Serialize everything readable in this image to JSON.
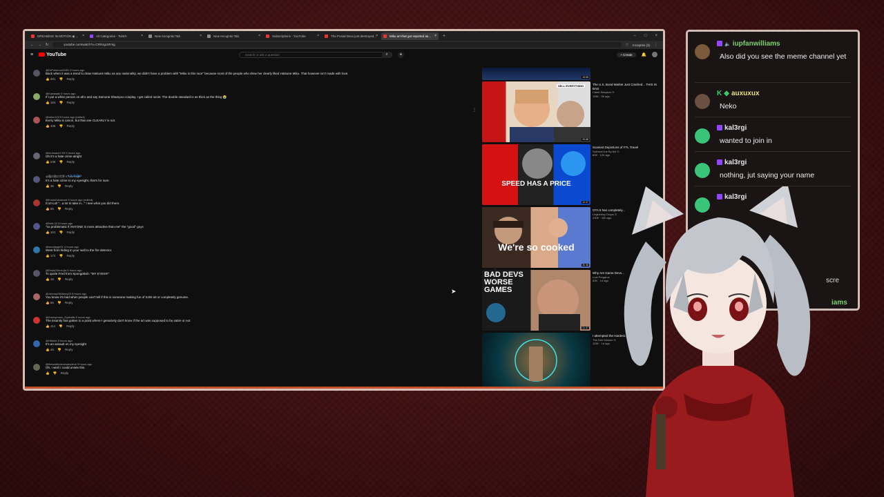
{
  "browser": {
    "tabs": [
      {
        "title": "DREAMING IN MOTION ◉ ..."
      },
      {
        "title": "All Categories - Twitch"
      },
      {
        "title": "New Incognito Tab"
      },
      {
        "title": "New Incognito Tab"
      },
      {
        "title": "Subscriptions - YouTube"
      },
      {
        "title": "The Postal Devs just destroyed..."
      },
      {
        "title": "Miku art that got reported as..."
      }
    ],
    "url": "youtube.com/watch?v=CRIiVgL5Fmg",
    "profile": "Incognito (3)"
  },
  "youtube": {
    "logo": "YouTube",
    "search_placeholder": "Search or ask a question",
    "create_label": "Create"
  },
  "comments": [
    {
      "user": "@DrPokemon2681 5 hours ago",
      "text": "Back when it was a trend to draw Hatsune Miku as any nationality, we didn't have a problem with \"Miku is this race\" because most of the people who drew her clearly liked Hatsune Miku. That however isn't made with love.",
      "likes": "481"
    },
    {
      "user": "@Kawasaki 5 hours ago",
      "text": "If I put a white person on afro and say Samurai Shampoo cosplay, I get called racist. The double standard is as thick as the thing 😭",
      "likes": "164"
    },
    {
      "user": "@iollux122 5 hours ago (edited)",
      "text": "Every Miku is canon, but that one CLEARLY is not.",
      "likes": "435"
    },
    {
      "user": "@mrinsane2.09 5 hours ago",
      "text": "Oh it's a hate crime alright",
      "likes": "238"
    },
    {
      "user": "@龍の歌の世界 5 hours ago",
      "text": "It's a hate crime to my eyesight, that's for sure.",
      "likes": "36"
    },
    {
      "user": "@KnutsDataword 5 hours ago (edited)",
      "text": "0:10 Lol! \"...a lot to take in...\" I see what you did there.",
      "likes": "65"
    },
    {
      "user": "@Nub.02 5 hours ago",
      "text": "\"so problematic if ANYONE is more attractive than me\" the \"good\" guys",
      "likes": "161"
    },
    {
      "user": "@sundayge01 4 hours ago",
      "text": "Went from hiding in your wall to the fire detector.",
      "likes": "172"
    },
    {
      "user": "@DustyStorm.jfa 5 hours ago",
      "text": "To quote Fred from SpongeBob: \"MY EYES!!!\"",
      "likes": "16"
    },
    {
      "user": "@JohnnyOfAbbey23 5 hours ago",
      "text": "You know it's bad when people can't tell if this is someone making fun of SJW art or completely genuine.",
      "likes": "66"
    },
    {
      "user": "@Anonymous_Eyeballs 5 hours ago",
      "text": "The insanity has gotten to a point where I genuinely don't know if the art was supposed to be satire or not",
      "likes": "114"
    },
    {
      "user": "@Hibeke 6 hours ago",
      "text": "It's an assault on my eyesight",
      "likes": "45"
    },
    {
      "user": "@thewaterpiecesanpiece 5 hours ago",
      "text": "Oh, I wish I could unsee this.",
      "likes": ""
    }
  ],
  "replies_label": "9 replies",
  "reply_label": "Reply",
  "videos": [
    {
      "title": "",
      "channel": "",
      "meta": "",
      "duration": "10:08",
      "overlay": ""
    },
    {
      "title": "The U.S. Bond Market Just Crashed... THIS IS BAD",
      "channel": "Caleb Simpson ⊙",
      "meta": "118K · 5h ago",
      "duration": "20:08",
      "overlay": "SELL EVERYTHING"
    },
    {
      "title": "Scariest Depictions of FTL Travel",
      "channel": "Science/Joe By Anl ⊙",
      "meta": "60K · 12h ago",
      "duration": "12:47",
      "overlay": "SPEED HAS A PRICE"
    },
    {
      "title": "GTA 6 has completely...",
      "channel": "Legendary Drops ⊙",
      "meta": "230K · 16h ago",
      "duration": "30:46",
      "overlay": "We're so cooked"
    },
    {
      "title": "Why Are Game Devs...",
      "channel": "Lost Pregame",
      "meta": "63K · 1d ago",
      "duration": "21:37",
      "overlay": "BAD DEVS WORSE GAMES"
    },
    {
      "title": "I attempted the Hardest... Gaming",
      "channel": "The Drih Kinsion ⊙",
      "meta": "113K · 1d ago",
      "duration": "",
      "overlay": ""
    }
  ],
  "chat": [
    {
      "user": "iupfanwilliams",
      "color": "#7cd36a",
      "text": "Also did you see the meme channel yet"
    },
    {
      "user": "auxuxux",
      "color": "#e9e37a",
      "text": "Neko"
    },
    {
      "user": "kal3rgi",
      "color": "#e6e6e6",
      "text": "wanted to join in"
    },
    {
      "user": "kal3rgi",
      "color": "#e6e6e6",
      "text": "nothing, jut saying your name"
    },
    {
      "user": "kal3rgi",
      "color": "#e6e6e6",
      "text": ""
    }
  ],
  "chat_partial": [
    "scre",
    "iams"
  ]
}
